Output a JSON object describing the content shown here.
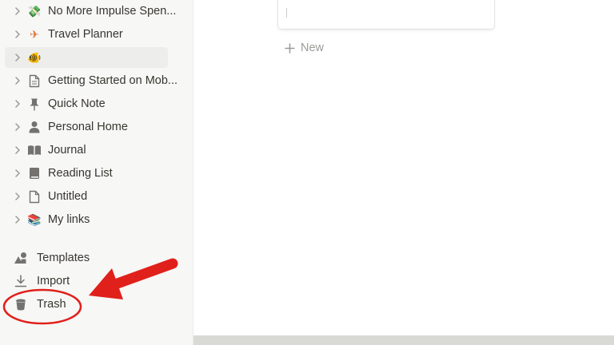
{
  "sidebar": {
    "pages": [
      {
        "label": "No More Impulse Spen...",
        "icon": "money-emoji",
        "glyph": "💸"
      },
      {
        "label": "Travel Planner",
        "icon": "airplane-emoji",
        "glyph": "✈"
      },
      {
        "label": "",
        "icon": "fish-emoji",
        "glyph": "🐠"
      },
      {
        "label": "Getting Started on Mob...",
        "icon": "page-icon",
        "glyph": ""
      },
      {
        "label": "Quick Note",
        "icon": "pushpin-icon",
        "glyph": ""
      },
      {
        "label": "Personal Home",
        "icon": "person-icon",
        "glyph": ""
      },
      {
        "label": "Journal",
        "icon": "open-book-icon",
        "glyph": ""
      },
      {
        "label": "Reading List",
        "icon": "book-icon",
        "glyph": ""
      },
      {
        "label": "Untitled",
        "icon": "page-icon",
        "glyph": ""
      },
      {
        "label": "My links",
        "icon": "books-emoji",
        "glyph": "📚"
      }
    ],
    "templates_label": "Templates",
    "import_label": "Import",
    "trash_label": "Trash"
  },
  "main": {
    "new_label": "New"
  },
  "annotation": {
    "color": "#e0201b"
  }
}
